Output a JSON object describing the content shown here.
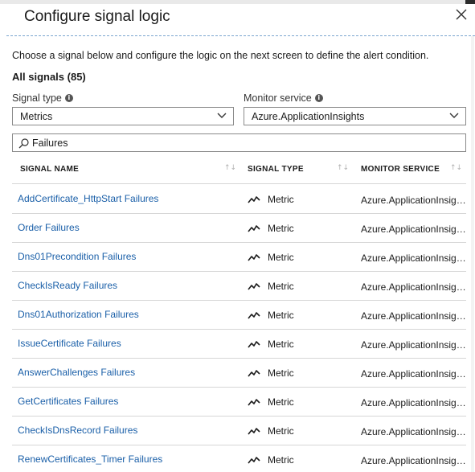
{
  "panel": {
    "title": "Configure signal logic",
    "description": "Choose a signal below and configure the logic on the next screen to define the alert condition.",
    "all_signals": "All signals (85)"
  },
  "filters": {
    "signal_type_label": "Signal type",
    "signal_type_value": "Metrics",
    "monitor_service_label": "Monitor service",
    "monitor_service_value": "Azure.ApplicationInsights",
    "search_value": "Failures"
  },
  "table": {
    "columns": [
      "SIGNAL NAME",
      "SIGNAL TYPE",
      "MONITOR SERVICE"
    ],
    "rows": [
      {
        "name": "AddCertificate_HttpStart Failures",
        "type": "Metric",
        "service": "Azure.ApplicationInsights"
      },
      {
        "name": "Order Failures",
        "type": "Metric",
        "service": "Azure.ApplicationInsights"
      },
      {
        "name": "Dns01Precondition Failures",
        "type": "Metric",
        "service": "Azure.ApplicationInsights"
      },
      {
        "name": "CheckIsReady Failures",
        "type": "Metric",
        "service": "Azure.ApplicationInsights"
      },
      {
        "name": "Dns01Authorization Failures",
        "type": "Metric",
        "service": "Azure.ApplicationInsights"
      },
      {
        "name": "IssueCertificate Failures",
        "type": "Metric",
        "service": "Azure.ApplicationInsights"
      },
      {
        "name": "AnswerChallenges Failures",
        "type": "Metric",
        "service": "Azure.ApplicationInsights"
      },
      {
        "name": "GetCertificates Failures",
        "type": "Metric",
        "service": "Azure.ApplicationInsights"
      },
      {
        "name": "CheckIsDnsRecord Failures",
        "type": "Metric",
        "service": "Azure.ApplicationInsights"
      },
      {
        "name": "RenewCertificates_Timer Failures",
        "type": "Metric",
        "service": "Azure.ApplicationInsights"
      }
    ]
  },
  "icons": {
    "close": "close-icon",
    "info": "info-icon",
    "chevron": "chevron-down-icon",
    "search": "search-icon",
    "metric": "metric-line-icon",
    "sort": "sort-icon"
  },
  "colors": {
    "link": "#1a5fa8",
    "accent_rule": "#7aa6cf"
  }
}
